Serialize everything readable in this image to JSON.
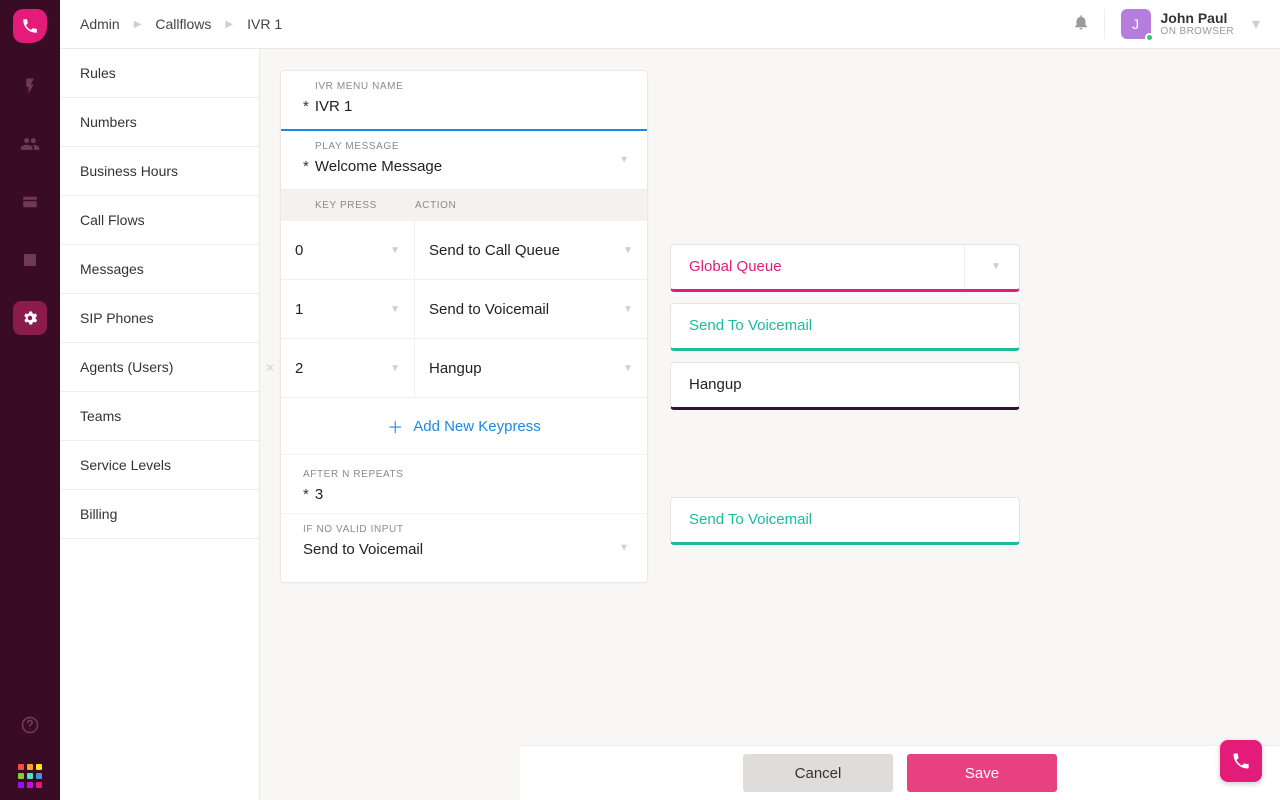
{
  "breadcrumb": {
    "a": "Admin",
    "b": "Callflows",
    "c": "IVR 1"
  },
  "user": {
    "initial": "J",
    "name": "John Paul",
    "status": "ON BROWSER"
  },
  "sidebar": {
    "items": [
      "Rules",
      "Numbers",
      "Business Hours",
      "Call Flows",
      "Messages",
      "SIP Phones",
      "Agents (Users)",
      "Teams",
      "Service Levels",
      "Billing"
    ]
  },
  "ivr": {
    "name_label": "IVR MENU NAME",
    "name_value": "IVR 1",
    "play_label": "PLAY MESSAGE",
    "play_value": "Welcome Message",
    "col_key": "KEY PRESS",
    "col_action": "ACTION",
    "rows": [
      {
        "key": "0",
        "action": "Send to Call Queue"
      },
      {
        "key": "1",
        "action": "Send to Voicemail"
      },
      {
        "key": "2",
        "action": "Hangup"
      }
    ],
    "add_label": "Add New Keypress",
    "after_label": "AFTER N REPEATS",
    "after_value": "3",
    "novalid_label": "IF NO VALID INPUT",
    "novalid_value": "Send to Voicemail"
  },
  "nodes": {
    "a": "Global Queue",
    "b": "Send To Voicemail",
    "c": "Hangup",
    "d": "Send To Voicemail"
  },
  "footer": {
    "cancel": "Cancel",
    "save": "Save"
  },
  "ast": "*"
}
